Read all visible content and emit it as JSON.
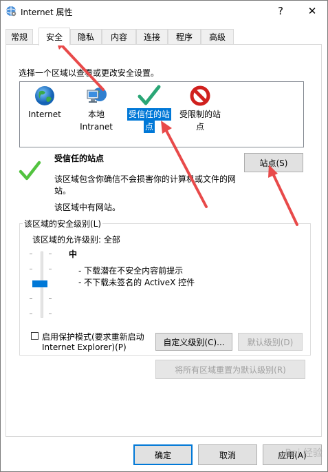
{
  "window": {
    "title": "Internet 属性",
    "help_label": "?",
    "close_label": "✕"
  },
  "tabs": [
    {
      "label": "常规"
    },
    {
      "label": "安全"
    },
    {
      "label": "隐私"
    },
    {
      "label": "内容"
    },
    {
      "label": "连接"
    },
    {
      "label": "程序"
    },
    {
      "label": "高级"
    }
  ],
  "security": {
    "prompt": "选择一个区域以查看或更改安全设置。",
    "zones": [
      {
        "label_line1": "Internet",
        "label_line2": "",
        "icon": "globe-icon"
      },
      {
        "label_line1": "本地",
        "label_line2": "Intranet",
        "icon": "intranet-icon"
      },
      {
        "label_line1": "受信任的站",
        "label_line2": "点",
        "icon": "green-check-icon",
        "selected": true
      },
      {
        "label_line1": "受限制的站",
        "label_line2": "点",
        "icon": "restricted-icon"
      }
    ],
    "zone_title": "受信任的站点",
    "zone_desc_line1": "该区域包含你确信不会损害你的计算机或文件的网",
    "zone_desc_line2": "站。",
    "zone_status": "该区域中有网站。",
    "sites_button": "站点(S)",
    "level_group_label": "该区域的安全级别(L)",
    "allowed_level": "该区域的允许级别: 全部",
    "level_name": "中",
    "level_bullets": [
      "- 下载潜在不安全内容前提示",
      "- 不下载未签名的 ActiveX 控件"
    ],
    "protected_mode_line1": "启用保护模式(要求重新启动",
    "protected_mode_line2": "Internet Explorer)(P)",
    "custom_level_button": "自定义级别(C)...",
    "default_level_button": "默认级别(D)",
    "reset_all_button": "将所有区域重置为默认级别(R)"
  },
  "footer": {
    "ok": "确定",
    "cancel": "取消",
    "apply": "应用(A)"
  },
  "watermark": "Bai 经验",
  "colors": {
    "accent": "#0078d7",
    "annotation_arrow": "#e84a4a"
  }
}
